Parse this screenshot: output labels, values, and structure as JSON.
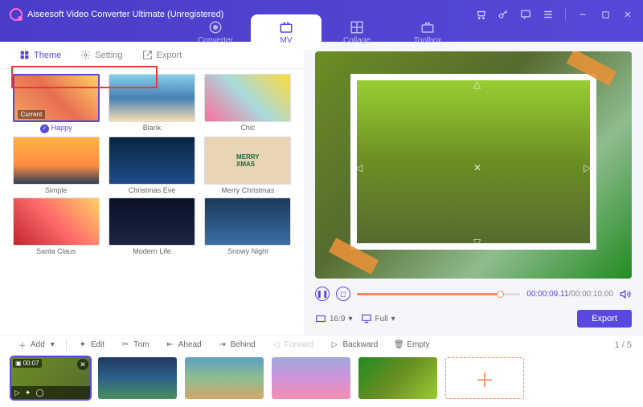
{
  "app": {
    "title": "Aiseesoft Video Converter Ultimate (Unregistered)"
  },
  "mainTabs": [
    {
      "label": "Converter"
    },
    {
      "label": "MV"
    },
    {
      "label": "Collage"
    },
    {
      "label": "Toolbox"
    }
  ],
  "subTabs": {
    "theme": "Theme",
    "setting": "Setting",
    "export": "Export"
  },
  "themes": [
    {
      "label": "Happy",
      "current": "Current"
    },
    {
      "label": "Blank"
    },
    {
      "label": "Chic"
    },
    {
      "label": "Simple"
    },
    {
      "label": "Christmas Eve"
    },
    {
      "label": "Merry Christmas"
    },
    {
      "label": "Santa Claus"
    },
    {
      "label": "Modern Life"
    },
    {
      "label": "Snowy Night"
    }
  ],
  "playback": {
    "current": "00:00:09.11",
    "total": "00:00:10.00",
    "sep": "/"
  },
  "display": {
    "ratio": "16:9",
    "mode": "Full"
  },
  "exportBtn": "Export",
  "tools": {
    "add": "Add",
    "edit": "Edit",
    "trim": "Trim",
    "ahead": "Ahead",
    "behind": "Behind",
    "forward": "Forward",
    "backward": "Backward",
    "empty": "Empty"
  },
  "pager": {
    "text": "1 / 5"
  },
  "clips": [
    {
      "duration": "00:07"
    }
  ]
}
